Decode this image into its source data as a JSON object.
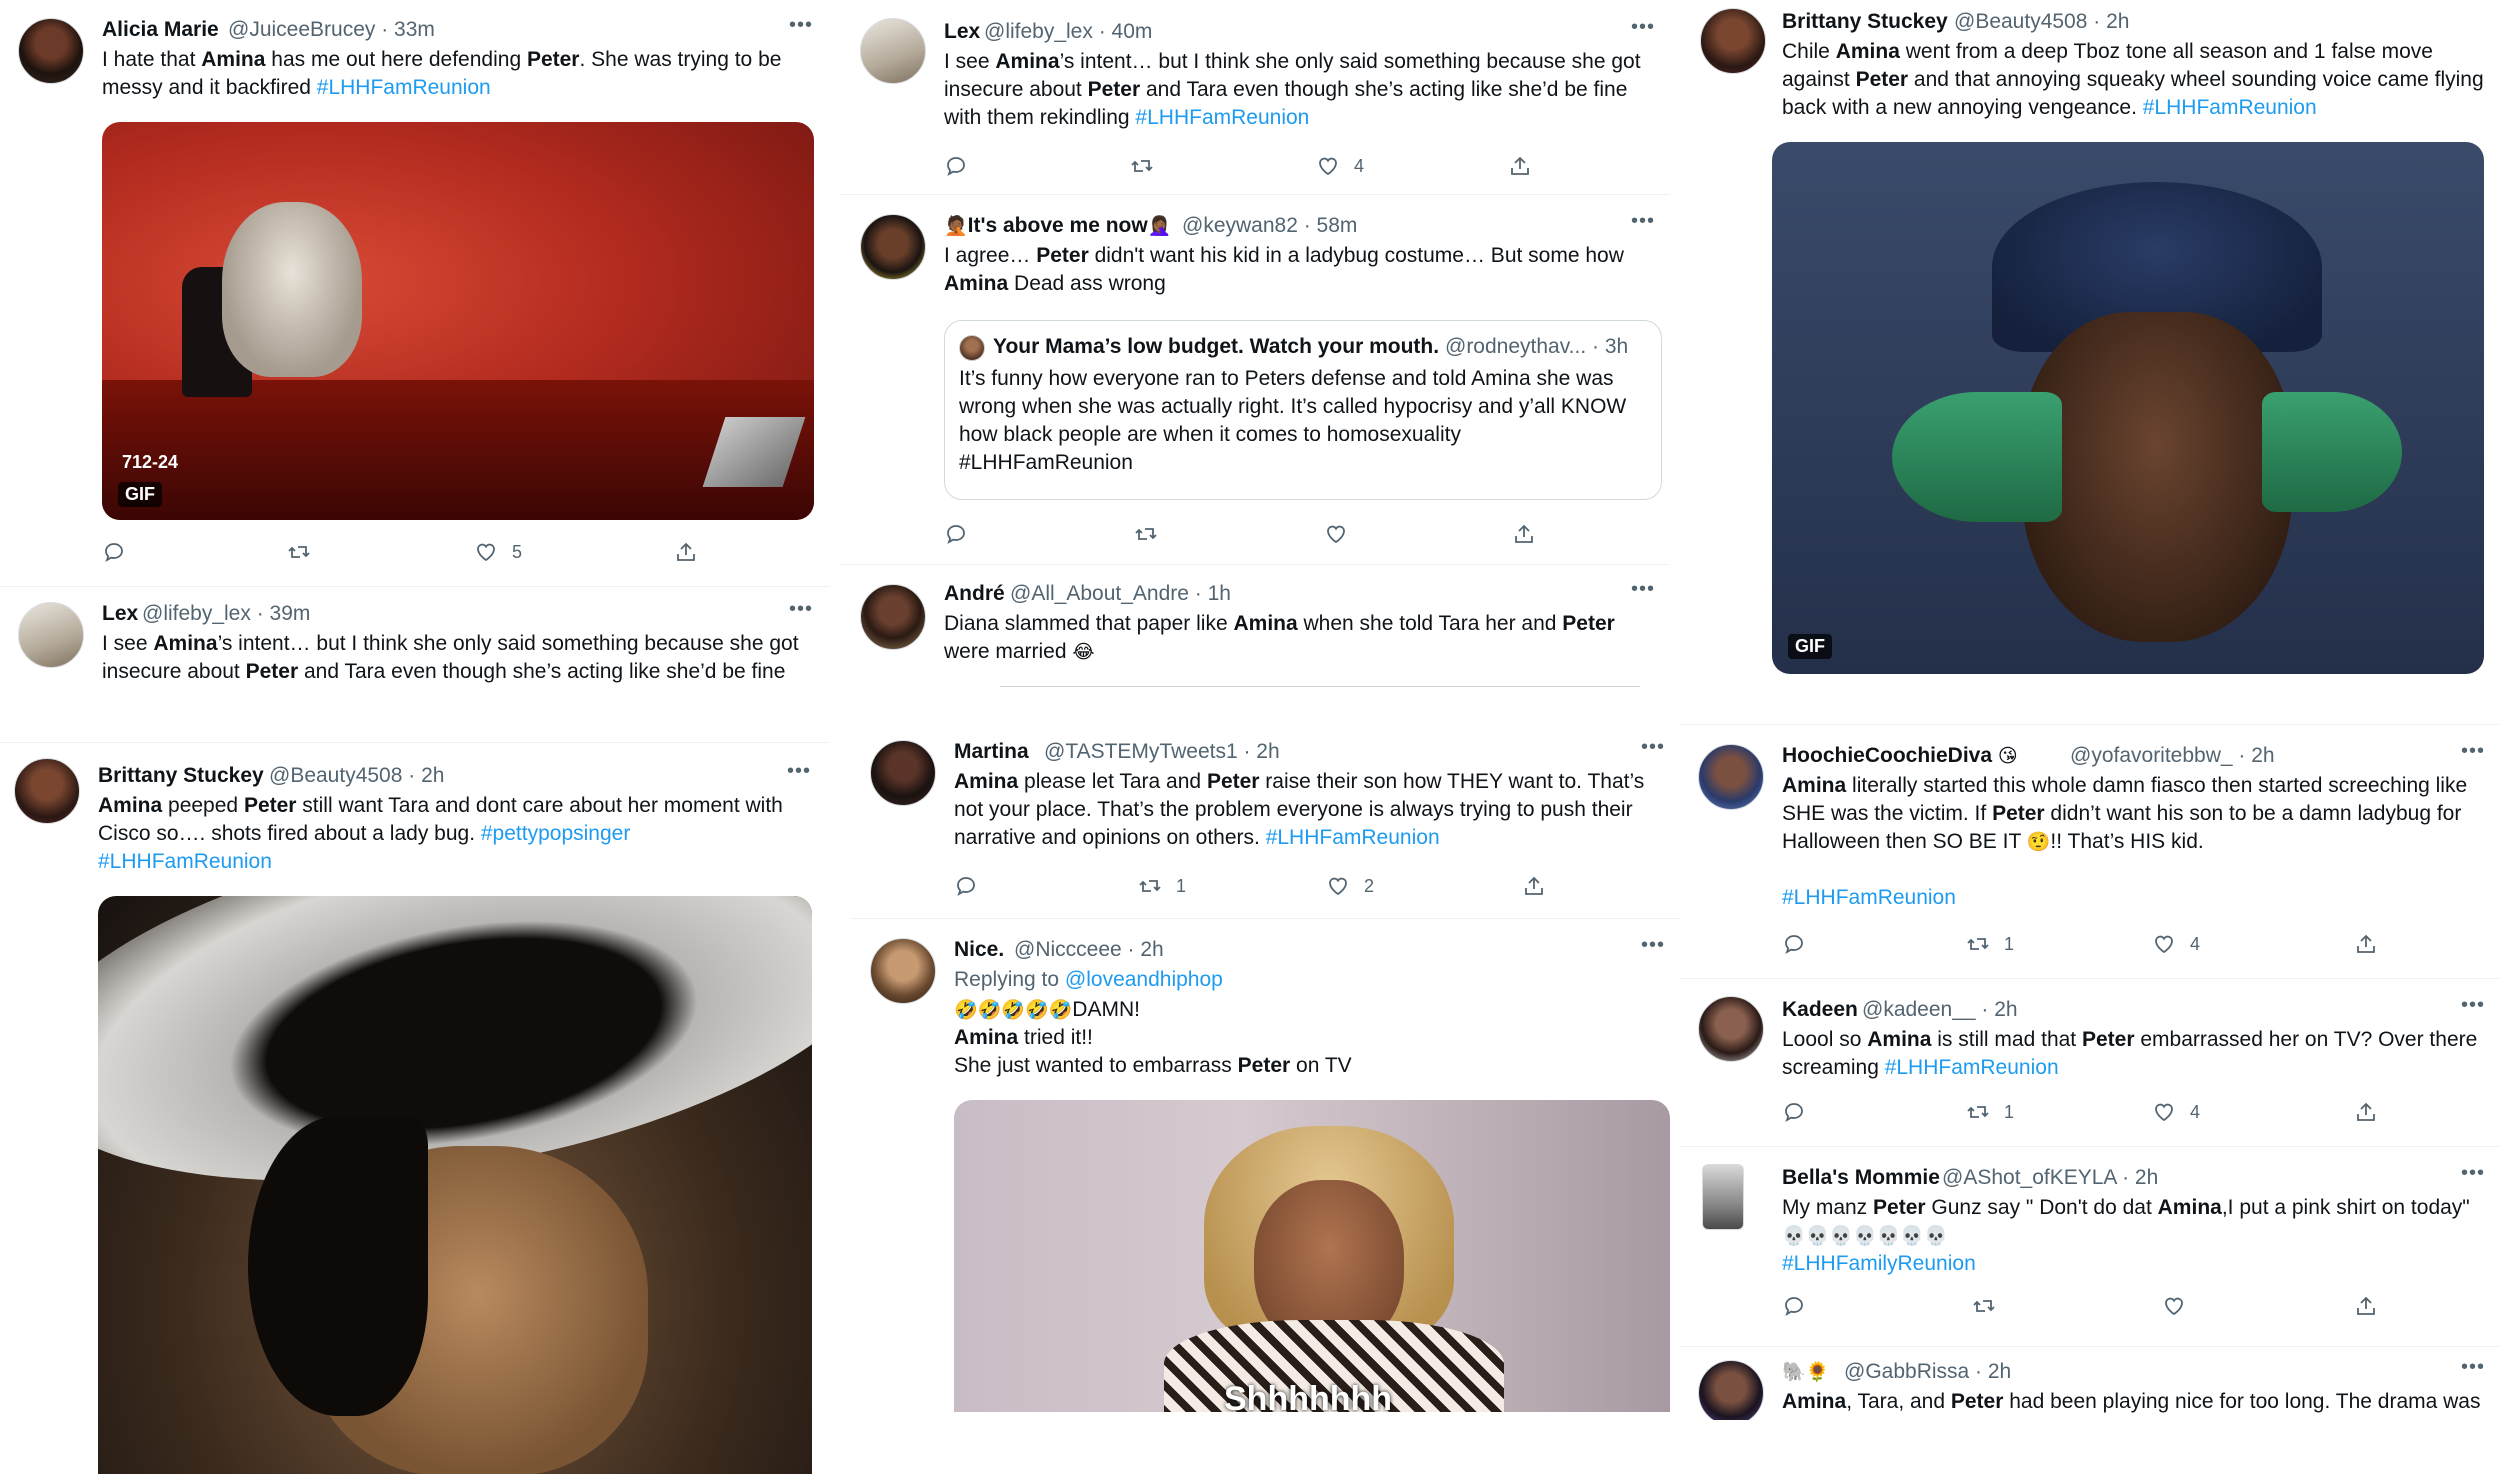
{
  "tweets": {
    "t1": {
      "name": "Alicia Marie",
      "handle": "@JuiceeBrucey",
      "time": "· 33m",
      "text": [
        "I hate that ",
        "Amina",
        " has me out here defending ",
        "Peter",
        ". She was trying to be messy and it backfired ",
        "#LHHFamReunion"
      ],
      "gif_caption": "712-24",
      "gif_badge": "GIF",
      "likes": "5"
    },
    "t2": {
      "name": "Lex",
      "handle": "@lifeby_lex",
      "time": "· 39m",
      "text": [
        "I see ",
        "Amina",
        "’s intent… but I think she only said something because she got insecure about ",
        "Peter",
        " and Tara even though she’s acting like she’d be fine"
      ]
    },
    "t3": {
      "name": "Brittany Stuckey",
      "handle": "@Beauty4508",
      "time": "· 2h",
      "text": [
        "Amina",
        " peeped ",
        "Peter",
        " still want Tara and dont care about her moment with Cisco so…. shots fired about a lady bug.   ",
        "#pettypopsinger",
        "#LHHFamReunion"
      ]
    },
    "t4": {
      "name": "Lex",
      "handle": "@lifeby_lex",
      "time": "· 40m",
      "text": [
        "I see ",
        "Amina",
        "’s intent… but I think she only said something because she got insecure about ",
        "Peter",
        " and Tara even though she’s acting like she’d be fine with them rekindling ",
        "#LHHFamReunion"
      ],
      "likes": "4"
    },
    "t5": {
      "name": "It's above me now",
      "name_emoji_left": "🤦🏾",
      "name_emoji_right": "🤦🏾‍♀️",
      "handle": "@keywan82",
      "time": "· 58m",
      "text": [
        "I agree… ",
        "Peter",
        " didn't want his kid in a ladybug costume… But some how ",
        "Amina",
        " Dead ass wrong"
      ],
      "quote": {
        "name": "Your Mama’s low budget. Watch your mouth.",
        "handle": "@rodneythav...",
        "time": "· 3h",
        "text": "It’s funny how everyone ran to Peters defense and told Amina she was wrong when she was actually right. It’s called hypocrisy and y’all KNOW how black people are when it comes to homosexuality",
        "hashtag": "#LHHFamReunion"
      }
    },
    "t6": {
      "name": "André",
      "handle": "@All_About_Andre",
      "time": "· 1h",
      "text": [
        "Diana slammed that paper like ",
        "Amina",
        " when she told Tara her and ",
        "Peter",
        " were married ",
        "😂"
      ]
    },
    "t7": {
      "name": "Martina",
      "handle": "@TASTEMyTweets1",
      "time": "· 2h",
      "text": [
        "Amina",
        " please let Tara and ",
        "Peter",
        " raise their son how THEY want to. That’s not your place. That’s the problem everyone is always trying to push their narrative and opinions on others. ",
        "#LHHFamReunion"
      ],
      "retweets": "1",
      "likes": "2"
    },
    "t8": {
      "name": "Nice.",
      "handle": "@Niccceee",
      "time": "· 2h",
      "replying_prefix": "Replying to ",
      "replying_to": "@loveandhiphop",
      "line1_emoji": "🤣🤣🤣🤣🤣",
      "line1_text": "DAMN!",
      "line2": [
        "Amina",
        " tried it!!"
      ],
      "line3": [
        "She just wanted to embarrass ",
        "Peter",
        " on TV"
      ],
      "gif_subtitle": "Shhhhhhh"
    },
    "t9": {
      "name": "Brittany Stuckey",
      "handle": "@Beauty4508",
      "time": "· 2h",
      "text": [
        "Chile ",
        "Amina",
        " went from a deep Tboz tone all season and 1 false move against ",
        "Peter",
        " and that annoying squeaky wheel sounding voice came flying back with a new annoying vengeance. ",
        "#LHHFamReunion"
      ],
      "gif_badge": "GIF"
    },
    "t10": {
      "name": "HoochieCoochieDiva",
      "name_emoji": "😘",
      "handle": "@yofavoritebbw_",
      "time": "· 2h",
      "text": [
        "Amina",
        " literally started this whole damn fiasco then started screeching like SHE was the victim. If ",
        "Peter",
        " didn’t want his son to be a damn ladybug for Halloween then SO BE IT ",
        "🤨",
        "!! That’s HIS kid."
      ],
      "hashtag": "#LHHFamReunion",
      "retweets": "1",
      "likes": "4"
    },
    "t11": {
      "name": "Kadeen",
      "handle": "@kadeen__",
      "time": "· 2h",
      "text": [
        "Loool so ",
        "Amina",
        " is still mad that ",
        "Peter",
        " embarrassed her on TV? Over there screaming ",
        "#LHHFamReunion"
      ],
      "retweets": "1",
      "likes": "4"
    },
    "t12": {
      "name": "Bella's Mommie",
      "handle": "@AShot_ofKEYLA",
      "time": "· 2h",
      "text": [
        "My manz ",
        "Peter",
        " Gunz say \" Don't do dat ",
        "Amina",
        ",I put a pink shirt on today\""
      ],
      "skulls": "💀💀💀💀💀💀💀",
      "hashtag": "#LHHFamilyReunion"
    },
    "t13": {
      "name_emoji": "🐘🌻",
      "handle": "@GabbRissa",
      "time": "· 2h",
      "text": [
        "Amina",
        ", Tara, and ",
        "Peter",
        " had been playing nice for too long. The drama was"
      ]
    }
  },
  "colors": {
    "link": "#1d9bf0",
    "text": "#0f1419",
    "secondary": "#536471",
    "border": "#eff3f4"
  },
  "icons": {
    "reply": "reply-icon",
    "retweet": "retweet-icon",
    "like": "like-icon",
    "share": "share-icon",
    "more": "more-icon"
  }
}
